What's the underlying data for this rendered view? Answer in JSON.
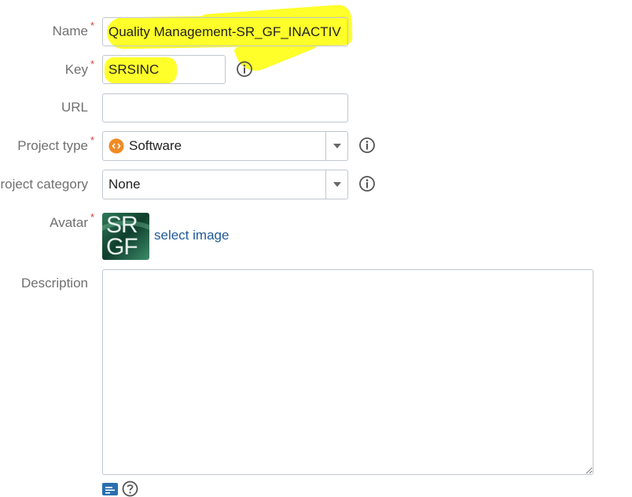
{
  "form": {
    "name": {
      "label": "Name",
      "required_mark": "*",
      "value": "Quality Management-SR_GF_INACTIV"
    },
    "key": {
      "label": "Key",
      "required_mark": "*",
      "value": "SRSINC"
    },
    "url": {
      "label": "URL",
      "value": ""
    },
    "project_type": {
      "label": "Project type",
      "required_mark": "*",
      "value": "Software",
      "icon": "software-type-icon"
    },
    "project_category": {
      "label": "roject category",
      "value": "None"
    },
    "avatar": {
      "label": "Avatar",
      "required_mark": "*",
      "image_text_line1": "SR",
      "image_text_line2": "GF",
      "select_link": "select image"
    },
    "description": {
      "label": "Description",
      "value": ""
    }
  },
  "colors": {
    "highlight": "#ffff2a",
    "required": "#d04437",
    "link": "#1f5a96",
    "software_badge": "#f08a24"
  },
  "icons": [
    "info-icon",
    "chevron-down-icon",
    "software-type-icon",
    "wiki-markup-icon",
    "help-icon"
  ]
}
